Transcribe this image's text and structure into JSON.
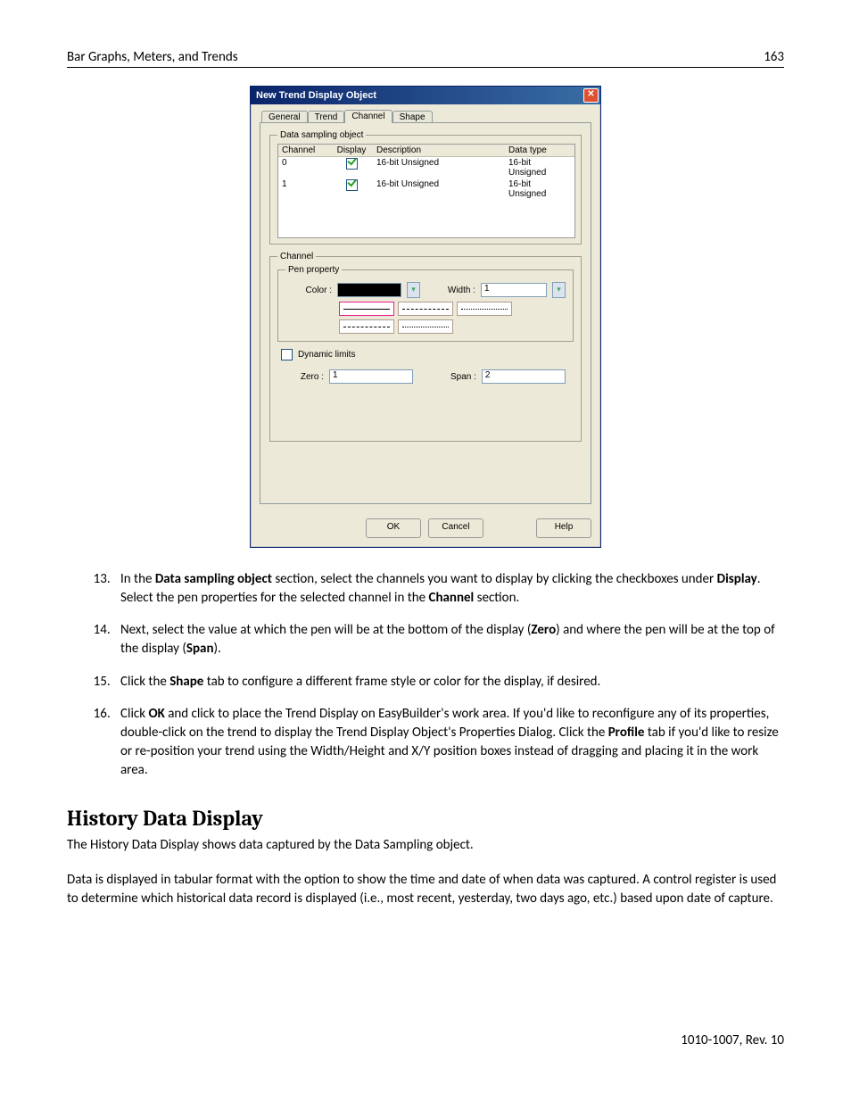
{
  "header": {
    "left": "Bar Graphs, Meters, and Trends",
    "right": "163"
  },
  "dialog": {
    "title": "New  Trend Display Object",
    "tabs": [
      "General",
      "Trend",
      "Channel",
      "Shape"
    ],
    "active_tab": "Channel",
    "group1_legend": "Data sampling object",
    "columns": {
      "channel": "Channel",
      "display": "Display",
      "description": "Description",
      "datatype": "Data type"
    },
    "rows": [
      {
        "channel": "0",
        "display": true,
        "description": "16-bit Unsigned",
        "datatype": "16-bit Unsigned"
      },
      {
        "channel": "1",
        "display": true,
        "description": "16-bit Unsigned",
        "datatype": "16-bit Unsigned"
      }
    ],
    "group2_legend": "Channel",
    "group3_legend": "Pen property",
    "color_label": "Color :",
    "width_label": "Width :",
    "width_value": "1",
    "dynamic_limits_label": "Dynamic limits",
    "zero_label": "Zero :",
    "zero_value": "1",
    "span_label": "Span :",
    "span_value": "2",
    "buttons": {
      "ok": "OK",
      "cancel": "Cancel",
      "help": "Help"
    }
  },
  "steps": {
    "start": 13,
    "items": [
      {
        "pre": "In the ",
        "b1": "Data sampling object",
        "mid1": " section, select the channels you want to display by clicking the checkboxes under ",
        "b2": "Display",
        "mid2": ". Select the pen properties for the selected channel in the ",
        "b3": "Channel",
        "post": " section."
      },
      {
        "pre": "Next, select the value at which the pen will be at the bottom of the display (",
        "b1": "Zero",
        "mid1": ") and where the pen will be at the top of the display (",
        "b2": "Span",
        "post": ")."
      },
      {
        "pre": "Click the ",
        "b1": "Shape",
        "post": " tab to configure a different frame style or color for the display, if desired."
      },
      {
        "pre": "Click ",
        "b1": "OK",
        "mid1": " and click to place the Trend Display on EasyBuilder's work area. If you'd like to reconfigure any of its properties, double-click on the trend to display the Trend Display Object's Properties Dialog. Click the ",
        "b2": "Profile",
        "post": " tab if you'd like to resize or re-position your trend using the Width/Height and X/Y position  boxes instead of dragging and placing it in the work area."
      }
    ]
  },
  "section": {
    "title": "History Data Display",
    "p1": "The History Data Display shows data captured by the Data Sampling object.",
    "p2": "Data is displayed in tabular format with the option to show the time and date of when data was captured. A control register is used to determine which historical data record is displayed (i.e., most recent, yesterday, two days ago, etc.) based upon date of capture."
  },
  "footer": "1010-1007, Rev. 10"
}
